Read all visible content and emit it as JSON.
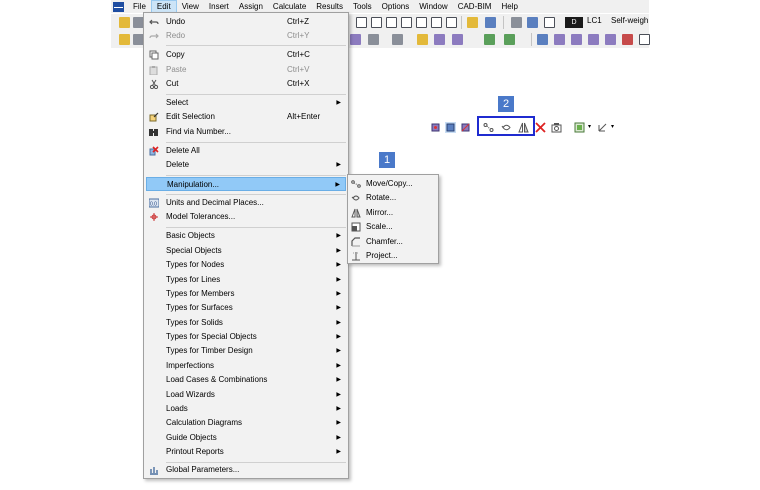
{
  "menubar": {
    "items": [
      "File",
      "Edit",
      "View",
      "Insert",
      "Assign",
      "Calculate",
      "Results",
      "Tools",
      "Options",
      "Window",
      "CAD-BIM",
      "Help"
    ],
    "active": "Edit"
  },
  "toolbar": {
    "design_situation": "D",
    "load_case": "LC1",
    "load_case_name": "Self-weigh"
  },
  "edit_menu": {
    "items": [
      {
        "label": "Undo",
        "shortcut": "Ctrl+Z",
        "icon": "undo-icon"
      },
      {
        "label": "Redo",
        "shortcut": "Ctrl+Y",
        "icon": "redo-icon",
        "disabled": true
      },
      {
        "label": "Copy",
        "shortcut": "Ctrl+C",
        "icon": "copy-icon"
      },
      {
        "label": "Paste",
        "shortcut": "Ctrl+V",
        "icon": "paste-icon",
        "disabled": true
      },
      {
        "label": "Cut",
        "shortcut": "Ctrl+X",
        "icon": "cut-icon"
      },
      {
        "label": "Select",
        "submenu": true
      },
      {
        "label": "Edit Selection",
        "shortcut": "Alt+Enter",
        "icon": "edit-selection-icon"
      },
      {
        "label": "Find via Number...",
        "icon": "find-icon"
      },
      {
        "label": "Delete All",
        "icon": "delete-all-icon"
      },
      {
        "label": "Delete",
        "submenu": true
      },
      {
        "label": "Manipulation...",
        "submenu": true,
        "highlighted": true
      },
      {
        "label": "Units and Decimal Places...",
        "icon": "units-icon"
      },
      {
        "label": "Model Tolerances...",
        "icon": "tolerances-icon"
      },
      {
        "label": "Basic Objects",
        "submenu": true
      },
      {
        "label": "Special Objects",
        "submenu": true
      },
      {
        "label": "Types for Nodes",
        "submenu": true
      },
      {
        "label": "Types for Lines",
        "submenu": true
      },
      {
        "label": "Types for Members",
        "submenu": true
      },
      {
        "label": "Types for Surfaces",
        "submenu": true
      },
      {
        "label": "Types for Solids",
        "submenu": true
      },
      {
        "label": "Types for Special Objects",
        "submenu": true
      },
      {
        "label": "Types for Timber Design",
        "submenu": true
      },
      {
        "label": "Imperfections",
        "submenu": true
      },
      {
        "label": "Load Cases & Combinations",
        "submenu": true
      },
      {
        "label": "Load Wizards",
        "submenu": true
      },
      {
        "label": "Loads",
        "submenu": true
      },
      {
        "label": "Calculation Diagrams",
        "submenu": true
      },
      {
        "label": "Guide Objects",
        "submenu": true
      },
      {
        "label": "Printout Reports",
        "submenu": true
      },
      {
        "label": "Global Parameters...",
        "icon": "global-parameters-icon"
      }
    ]
  },
  "manipulation_submenu": {
    "items": [
      {
        "label": "Move/Copy...",
        "icon": "move-copy-icon"
      },
      {
        "label": "Rotate...",
        "icon": "rotate-icon"
      },
      {
        "label": "Mirror...",
        "icon": "mirror-icon"
      },
      {
        "label": "Scale...",
        "icon": "scale-icon"
      },
      {
        "label": "Chamfer...",
        "icon": "chamfer-icon"
      },
      {
        "label": "Project...",
        "icon": "project-icon"
      }
    ]
  },
  "callouts": {
    "one": "1",
    "two": "2"
  },
  "colors": {
    "highlight": "#91c9f7",
    "callout_badge": "#4a79c9",
    "callout_box": "#1f2bd0"
  }
}
